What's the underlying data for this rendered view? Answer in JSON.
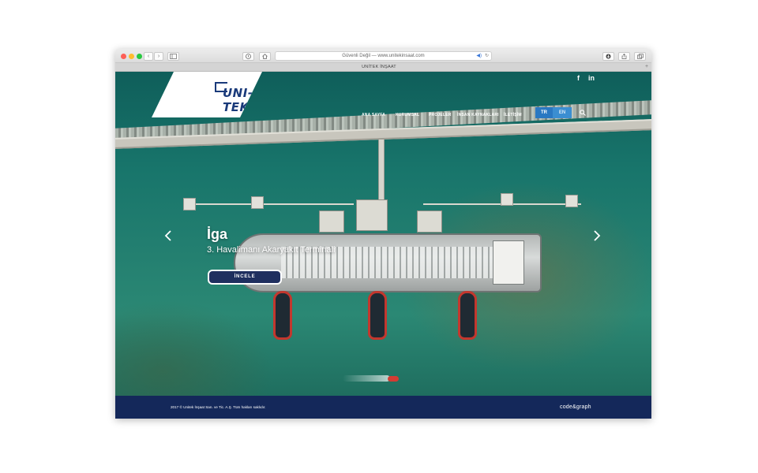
{
  "browser": {
    "address": "Güvenli Değil — www.unitekinsaat.com",
    "tab_title": "UNİTEK İNŞAAT",
    "back_icon": "‹",
    "forward_icon": "›",
    "plus": "+"
  },
  "header": {
    "logo_text": "UNI-TEK",
    "social": {
      "facebook": "f",
      "linkedin": "in"
    },
    "nav": [
      "ANA SAYFA",
      "KURUMSAL",
      "PROJELER",
      "İNSAN KAYNAKLARI",
      "İLETİŞİM"
    ],
    "lang": {
      "tr": "TR",
      "en": "EN"
    }
  },
  "slider": {
    "title": "İga",
    "subtitle": "3. Havalimanı Akaryakıt Terminali",
    "button": "İNCELE"
  },
  "footer": {
    "copyright": "2017 © Unitek İnşaat San. ve Tic. A.Ş. Tüm hakları saklıdır.",
    "credit": "code&graph"
  },
  "colors": {
    "navy": "#14285a",
    "lang_tr": "#2a78c2",
    "lang_en": "#3b8ed1",
    "logo": "#1a3a7a"
  }
}
